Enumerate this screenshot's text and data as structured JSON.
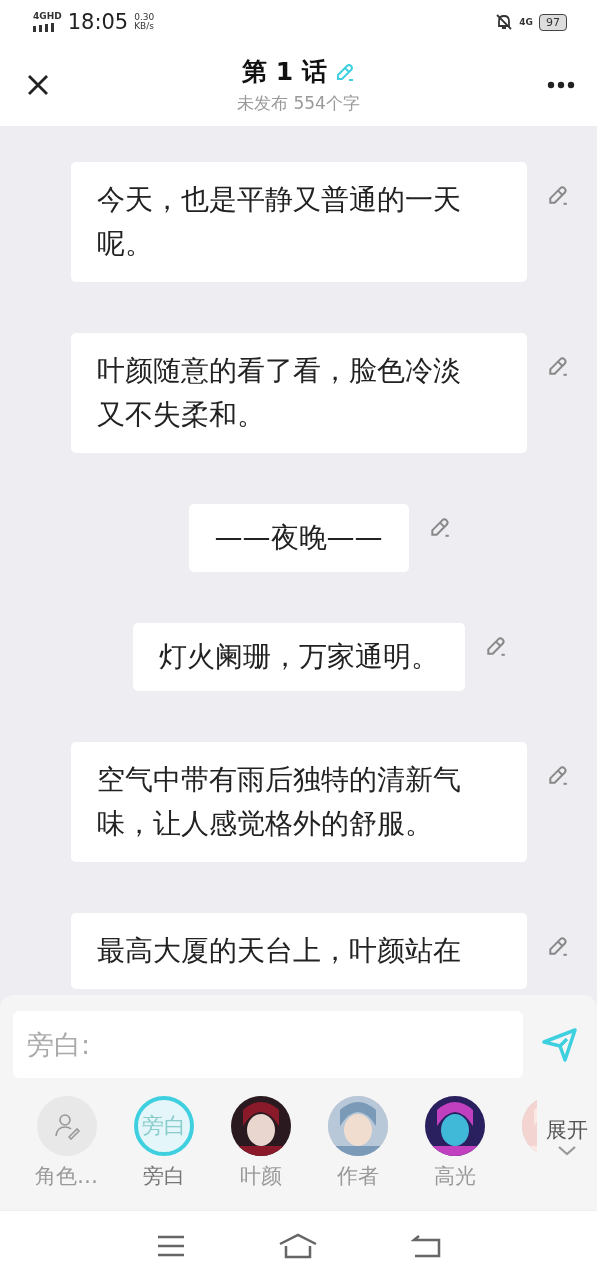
{
  "status_bar": {
    "network": "4GHD",
    "time": "18:05",
    "speed": "0.30",
    "speed_unit": "KB/s",
    "data": "4G",
    "battery": "97"
  },
  "header": {
    "title": "第 1 话",
    "subtitle": "未发布 554个字"
  },
  "paragraphs": [
    {
      "kind": "wide",
      "text": "今天，也是平静又普通的一天呢。"
    },
    {
      "kind": "wide",
      "text": "叶颜随意的看了看，脸色冷淡又不失柔和。"
    },
    {
      "kind": "centered",
      "text": "——夜晚——"
    },
    {
      "kind": "centered",
      "text": "灯火阑珊，万家通明。"
    },
    {
      "kind": "wide",
      "text": "空气中带有雨后独特的清新气味，让人感觉格外的舒服。"
    },
    {
      "kind": "wide",
      "text": "最高大厦的天台上，叶颜站在"
    }
  ],
  "composer": {
    "placeholder": "旁白:"
  },
  "characters": [
    {
      "kind": "add",
      "label": "角色…",
      "selected": false
    },
    {
      "kind": "text",
      "avatar": "旁白",
      "label": "旁白",
      "selected": true
    },
    {
      "kind": "picture",
      "label": "叶颜",
      "selected": false
    },
    {
      "kind": "picture",
      "label": "作者",
      "selected": false
    },
    {
      "kind": "picture",
      "label": "高光",
      "selected": false
    },
    {
      "kind": "picture",
      "selected": false
    }
  ],
  "expand": {
    "label": "展开"
  }
}
